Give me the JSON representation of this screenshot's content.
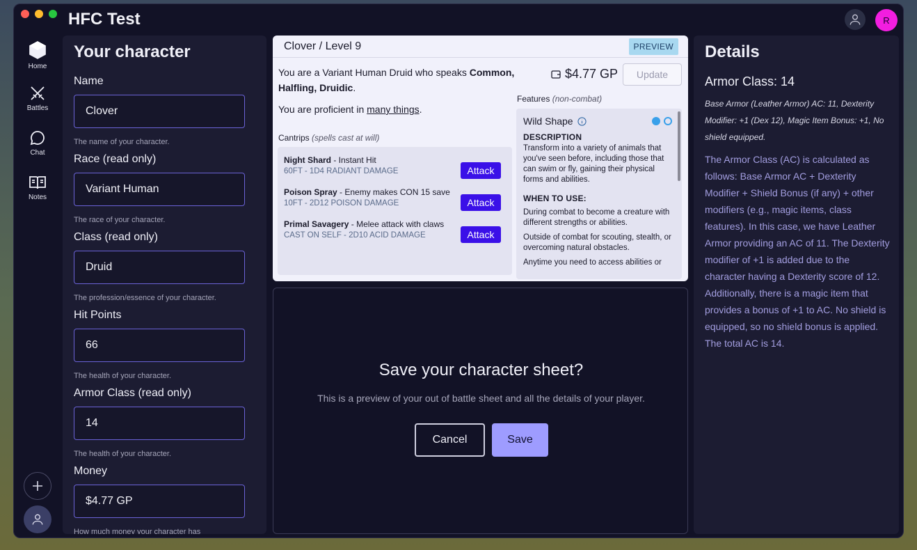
{
  "app": {
    "title": "HFC Test",
    "avatar_initial": "R"
  },
  "sidebar": {
    "items": [
      {
        "label": "Home",
        "icon": "home-icon"
      },
      {
        "label": "Battles",
        "icon": "swords-icon"
      },
      {
        "label": "Chat",
        "icon": "chat-icon"
      },
      {
        "label": "Notes",
        "icon": "book-icon"
      }
    ],
    "add_icon": "plus-icon",
    "profile_icon": "user-icon"
  },
  "character_form": {
    "heading": "Your character",
    "fields": [
      {
        "label": "Name",
        "value": "Clover",
        "help": "The name of your character."
      },
      {
        "label": "Race (read only)",
        "value": "Variant Human",
        "help": "The race of your character."
      },
      {
        "label": "Class (read only)",
        "value": "Druid",
        "help": "The profession/essence of your character."
      },
      {
        "label": "Hit Points",
        "value": "66",
        "help": "The health of your character."
      },
      {
        "label": "Armor Class (read only)",
        "value": "14",
        "help": "The health of your character."
      },
      {
        "label": "Money",
        "value": "$4.77 GP",
        "help": "How much money your character has"
      }
    ]
  },
  "preview": {
    "title": "Clover / Level 9",
    "badge": "PREVIEW",
    "intro_prefix": "You are a Variant Human Druid who speaks ",
    "languages": "Common, Halfling, Druidic",
    "intro_suffix": ".",
    "prof_prefix": "You are proficient in ",
    "prof_link": "many things",
    "prof_suffix": ".",
    "money": "$4.77 GP",
    "update_label": "Update",
    "cantrips_label": "Cantrips",
    "cantrips_note": "(spells cast at will)",
    "cantrips": [
      {
        "name": "Night Shard",
        "desc": " - Instant Hit",
        "detail": "60FT - 1D4 RADIANT DAMAGE",
        "action": "Attack"
      },
      {
        "name": "Poison Spray",
        "desc": " - Enemy makes CON 15 save",
        "detail": "10FT - 2D12 POISON DAMAGE",
        "action": "Attack"
      },
      {
        "name": "Primal Savagery",
        "desc": " - Melee attack with claws",
        "detail": "CAST ON SELF - 2D10 ACID DAMAGE",
        "action": "Attack"
      }
    ],
    "features_label": "Features",
    "features_note": "(non-combat)",
    "feature": {
      "title": "Wild Shape",
      "desc_heading": "DESCRIPTION",
      "desc": "Transform into a variety of animals that you've seen before, including those that can swim or fly, gaining their physical forms and abilities.",
      "when_heading": "WHEN TO USE:",
      "when": [
        "During combat to become a creature with different strengths or abilities.",
        "Outside of combat for scouting, stealth, or overcoming natural obstacles.",
        "Anytime you need to access abilities or"
      ]
    }
  },
  "dialog": {
    "title": "Save your character sheet?",
    "message": "This is a preview of your out of battle sheet and all the details of your player.",
    "cancel_label": "Cancel",
    "save_label": "Save"
  },
  "details": {
    "heading": "Details",
    "ac_title": "Armor Class: 14",
    "ac_breakdown": "Base Armor (Leather Armor) AC: 11, Dexterity Modifier: +1 (Dex 12), Magic Item Bonus: +1, No shield equipped.",
    "ac_explanation": "The Armor Class (AC) is calculated as follows: Base Armor AC + Dexterity Modifier + Shield Bonus (if any) + other modifiers (e.g., magic items, class features). In this case, we have Leather Armor providing an AC of 11. The Dexterity modifier of +1 is added due to the character having a Dexterity score of 12. Additionally, there is a magic item that provides a bonus of +1 to AC. No shield is equipped, so no shield bonus is applied. The total AC is 14."
  },
  "colors": {
    "accent": "#3a10e8",
    "save": "#9e9cff",
    "avatar": "#f21ee0",
    "info": "#39a0ea"
  }
}
